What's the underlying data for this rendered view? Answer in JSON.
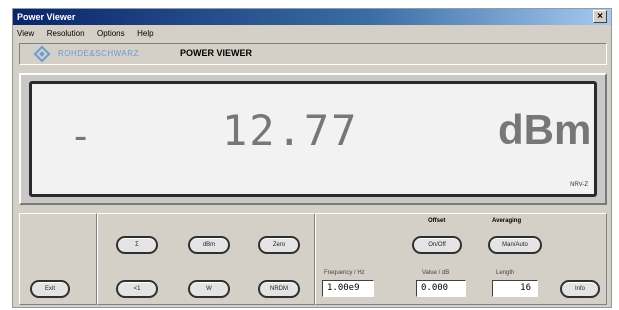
{
  "window": {
    "title": "Power Viewer",
    "close": "×"
  },
  "menu": {
    "items": [
      "View",
      "Resolution",
      "Options",
      "Help"
    ]
  },
  "header": {
    "brand": "ROHDE&SCHWARZ",
    "product": "POWER VIEWER"
  },
  "display": {
    "sign": "-",
    "value": "12.77",
    "unit": "dBm",
    "model": "NRV-Z"
  },
  "controls": {
    "left": {
      "exit_label": "Exit"
    },
    "keypad": {
      "row1": [
        "Σ",
        "dBm",
        "Zero"
      ],
      "row2": [
        "<1",
        "W",
        "NRDM"
      ]
    },
    "offset": {
      "label": "Offset",
      "button": "On/Off"
    },
    "averaging": {
      "label": "Averaging",
      "button": "Man/Auto"
    },
    "frequency": {
      "label": "Frequency / Hz",
      "value": "1.00e9"
    },
    "value": {
      "label": "Value / dB",
      "value": "0.000"
    },
    "length": {
      "label": "Length",
      "value": "16"
    },
    "info_label": "Info"
  }
}
